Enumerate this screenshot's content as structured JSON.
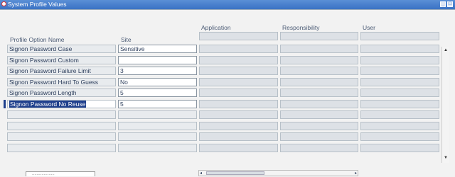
{
  "window": {
    "title": "System Profile Values"
  },
  "headers": {
    "profile_option_name": "Profile Option Name",
    "site": "Site",
    "application": "Application",
    "responsibility": "Responsibility",
    "user": "User"
  },
  "rows": [
    {
      "name": "Signon Password Case",
      "site": "Sensitive"
    },
    {
      "name": "Signon Password Custom",
      "site": ""
    },
    {
      "name": "Signon Password Failure Limit",
      "site": "3"
    },
    {
      "name": "Signon Password Hard To Guess",
      "site": "No"
    },
    {
      "name": "Signon Password Length",
      "site": "5"
    },
    {
      "name": "Signon Password No Reuse",
      "site": "5"
    }
  ],
  "bottom_fragment": "...................",
  "colors": {
    "titlebar": "#3a72c4",
    "selection": "#1e3f8c"
  },
  "icons": {
    "app": "oracle-app-icon",
    "minimize": "minimize-icon",
    "maximize": "maximize-icon"
  }
}
